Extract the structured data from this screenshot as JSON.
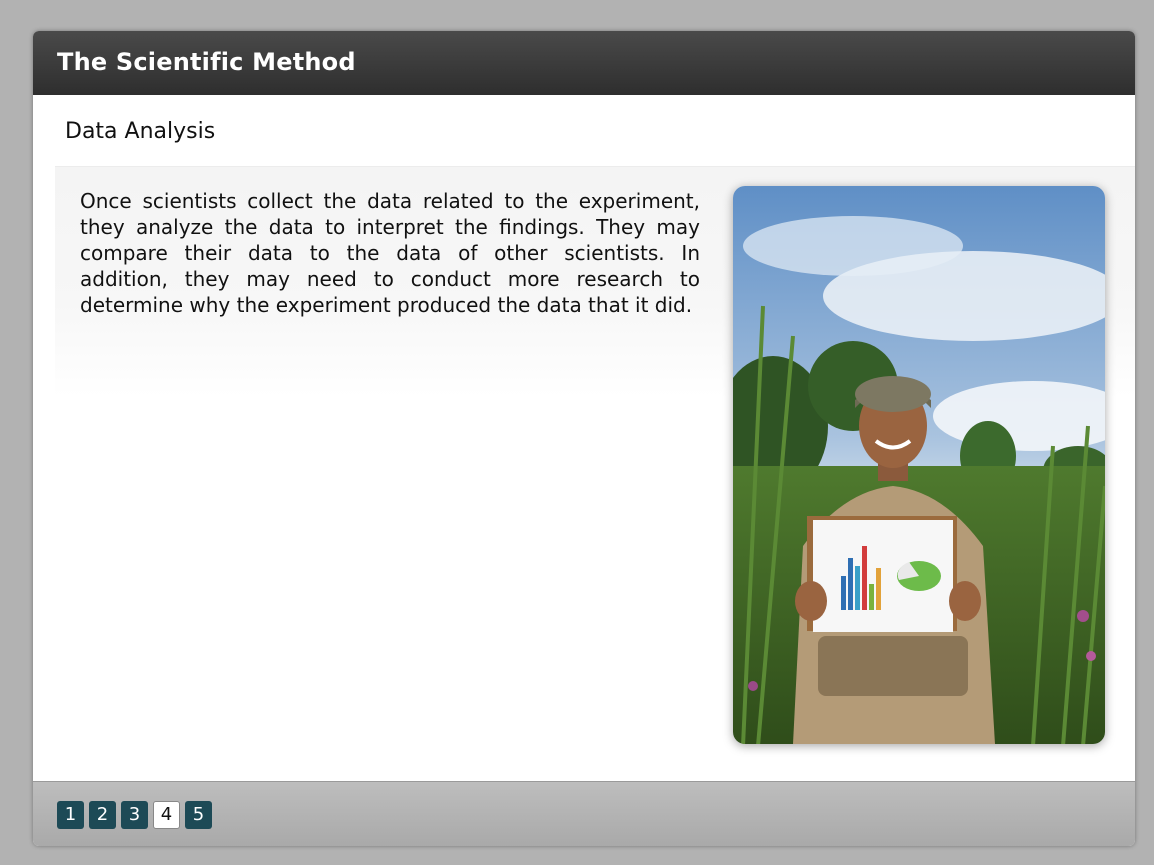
{
  "window": {
    "title": "The Scientific Method"
  },
  "section": {
    "title": "Data Analysis"
  },
  "content": {
    "body": "Once scientists collect the data related to the experiment, they analyze the data to interpret the findings.  They may compare their data to the data of other scientists.  In addition, they may need to conduct more research to determine why the experiment produced the data that it did."
  },
  "pager": {
    "pages": [
      "1",
      "2",
      "3",
      "4",
      "5"
    ],
    "current": "4"
  },
  "colors": {
    "titlebar": "#3a3a3a",
    "page_button": "#1d4a56",
    "page_button_active": "#ffffff",
    "footer": "#b0b0b0"
  },
  "photo": {
    "icon": "person-holding-chart-photo"
  }
}
